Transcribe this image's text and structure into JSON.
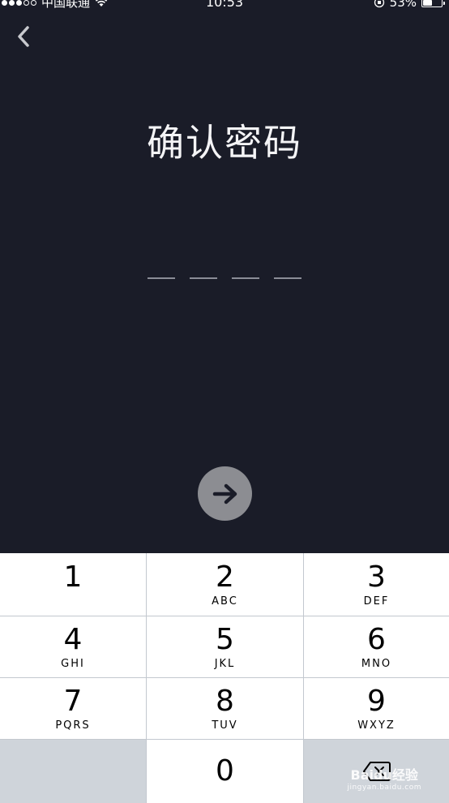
{
  "status_bar": {
    "carrier": "中国联通",
    "time": "10:53",
    "battery_percent": "53%",
    "battery_level": 0.53,
    "signal_bars_filled": 3,
    "signal_bars_total": 5
  },
  "header": {
    "back_icon": "chevron-left-icon",
    "title": "确认密码"
  },
  "pin": {
    "length": 4,
    "filled": 0
  },
  "next_button": {
    "icon": "arrow-right-icon",
    "color": "#8c8d92"
  },
  "keypad": {
    "keys": [
      {
        "digit": "1",
        "letters": ""
      },
      {
        "digit": "2",
        "letters": "ABC"
      },
      {
        "digit": "3",
        "letters": "DEF"
      },
      {
        "digit": "4",
        "letters": "GHI"
      },
      {
        "digit": "5",
        "letters": "JKL"
      },
      {
        "digit": "6",
        "letters": "MNO"
      },
      {
        "digit": "7",
        "letters": "PQRS"
      },
      {
        "digit": "8",
        "letters": "TUV"
      },
      {
        "digit": "9",
        "letters": "WXYZ"
      },
      {
        "digit": "0",
        "letters": ""
      }
    ],
    "delete_icon": "backspace-icon"
  },
  "watermark": {
    "brand": "Baidu经验",
    "url": "jingyan.baidu.com"
  },
  "colors": {
    "background": "#1a1c28",
    "key_bg": "#ffffff",
    "keypad_bg": "#c3c8cf"
  }
}
